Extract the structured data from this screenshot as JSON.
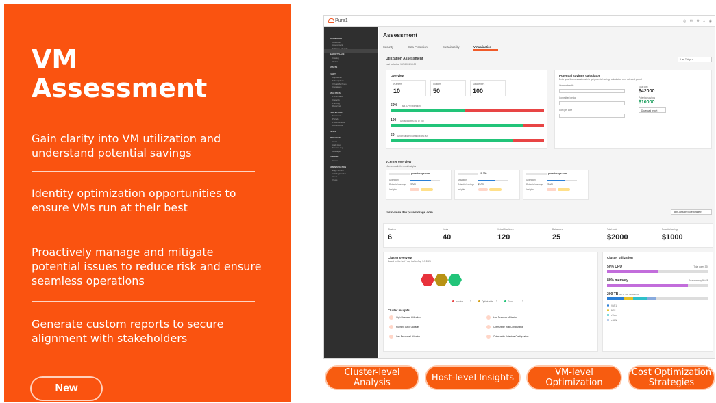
{
  "promo": {
    "title_line1": "VM",
    "title_line2": "Assessment",
    "bullets": [
      "Gain clarity into VM utilization and understand potential savings",
      "Identity optimization opportunities to ensure VMs run at their best",
      "Proactively manage and mitigate potential issues to reduce risk and ensure seamless operations",
      "Generate custom reports to secure alignment with stakeholders"
    ],
    "new_label": "New"
  },
  "features": [
    "Cluster-level Analysis",
    "Host-level Insights",
    "VM-level Optimization",
    "Cost Optimization Strategies"
  ],
  "app": {
    "logo": "Pure1",
    "page_title": "Assessment",
    "tabs": [
      "Security",
      "Data Protection",
      "Sustainability",
      "Virtualization"
    ],
    "active_tab": "Virtualization",
    "util_title": "Utilization Assessment",
    "last_collection": "Last collection 12/5/2024 13:00",
    "range_select": "Last 7 days",
    "overview_title": "Overview",
    "stats": [
      {
        "label": "vCenters",
        "value": "10"
      },
      {
        "label": "Clusters",
        "value": "50"
      },
      {
        "label": "Datacenters",
        "value": "100"
      }
    ],
    "util_rows": [
      {
        "value": "50%",
        "label": "avg. CPU utilization",
        "fill": 0.48
      },
      {
        "value": "100",
        "label": "Unused cores out of 750",
        "fill": 0.86
      },
      {
        "value": "50",
        "label": "Under-utilized hosts out of 1000",
        "fill": 0.8
      }
    ],
    "savings": {
      "title": "Potential savings calculator",
      "subtitle": "Enter your licenses and costs to get potential savings calculation over selected period",
      "license_label": "License bundle",
      "period_label": "Committed period",
      "cost_label": "Cost per core",
      "total_cost_label": "Total cost",
      "total_cost": "$42000",
      "potential_label": "Potential savings",
      "potential": "$10000",
      "download": "Download report"
    },
    "vcenter": {
      "title": "vCenter overview",
      "subtitle": "vCenters with the most insights",
      "cards": [
        {
          "name": "purestorage.com",
          "util": 0.7
        },
        {
          "name": "10.220",
          "util": 0.55
        },
        {
          "name": "purestorage.com",
          "util": 0.6
        }
      ],
      "row_labels": [
        "Utilization",
        "Potential savings",
        "Insights"
      ],
      "savings_value": "$1000"
    },
    "host": "fastn-vcsa.dev.purestorage.com",
    "host_select": "fastn-vcsa.dev.purestorage",
    "kpis": [
      {
        "label": "Clusters",
        "value": "6"
      },
      {
        "label": "Hosts",
        "value": "40"
      },
      {
        "label": "Virtual Machines",
        "value": "120"
      },
      {
        "label": "Datastores",
        "value": "25"
      },
      {
        "label": "Total costs",
        "value": "$2000"
      },
      {
        "label": "Potential savings",
        "value": "$1000"
      }
    ],
    "cluster_overview": {
      "title": "Cluster overview",
      "subtitle": "Based on the last 7 day traffic, Aug 1-7 2024",
      "legend": [
        {
          "label": "Inactive",
          "count": "1",
          "color": "#e84545"
        },
        {
          "label": "Optimizable",
          "count": "1",
          "color": "#d4a017"
        },
        {
          "label": "Good",
          "count": "1",
          "color": "#22c479"
        }
      ],
      "insights_title": "Cluster insights",
      "insights_left": [
        "High Resource Utilization",
        "Running out of Capacity",
        "Low Resource Utilization"
      ],
      "insights_right": [
        "Low Resource Utilization",
        "Optimizable Host Configuration",
        "Optimizable Datastore Configuration"
      ]
    },
    "cluster_util": {
      "title": "Cluster utilization",
      "cpu": "50% CPU",
      "cpu_total": "Total cores 320",
      "memory": "80% memory",
      "memory_total": "Total memory 80 GB",
      "storage": "200 TB",
      "storage_sub": "out of 500 TB utilized",
      "cpu_fill": 0.5,
      "mem_fill": 0.8,
      "legend": [
        "VVF1",
        "NFS",
        "vVols",
        "vSAN"
      ]
    },
    "sidebar": [
      "DASHBOARD",
      "Overview",
      "Assessment",
      "Software Lifecycle",
      "MARKETPLACE",
      "Catalog",
      "Orders",
      "ASSETS",
      "FLEET",
      "Appliances",
      "Subscriptions",
      "Virtual Machines",
      "Containers",
      "ANALYTICS",
      "Performance",
      "Capacity",
      "Planning",
      "Reporting",
      "PROTECTION",
      "Snapshots",
      "Periods",
      "ProtectGroups",
      "ActiveCluster",
      "VIEWS",
      "MESSAGES",
      "Alerts",
      "Audit Log",
      "Session Log",
      "Messages",
      "SUPPORT",
      "Cases",
      "ADMINISTRATION",
      "Edge Service",
      "API Registration",
      "Users",
      "Views"
    ]
  }
}
